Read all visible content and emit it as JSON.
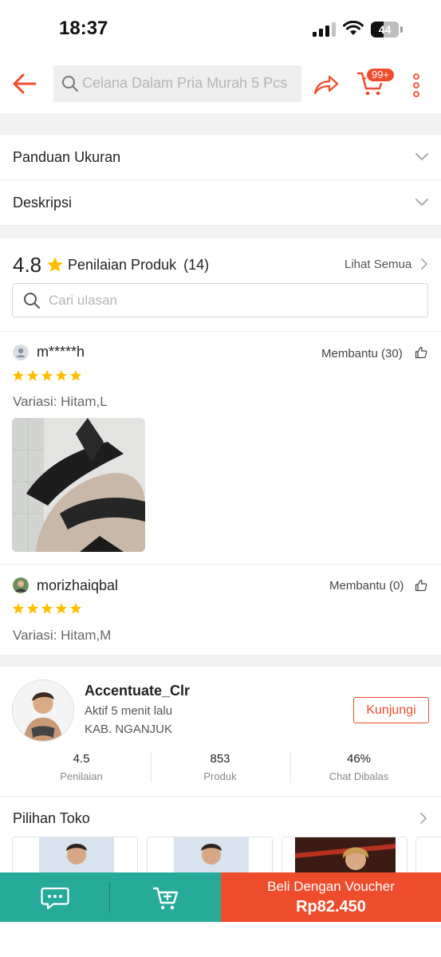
{
  "status_bar": {
    "time": "18:37",
    "battery": "44"
  },
  "header": {
    "search_placeholder": "Celana Dalam Pria Murah 5 Pcs",
    "cart_badge": "99+",
    "icons": [
      "back-arrow-icon",
      "search-icon",
      "share-icon",
      "cart-icon",
      "more-vertical-icon"
    ]
  },
  "accordion": [
    {
      "label": "Panduan Ukuran"
    },
    {
      "label": "Deskripsi"
    }
  ],
  "ratings": {
    "score": "4.8",
    "title": "Penilaian Produk",
    "count": "(14)",
    "see_all": "Lihat Semua",
    "search_placeholder": "Cari ulasan"
  },
  "reviews": [
    {
      "name": "m*****h",
      "helpful": "Membantu (30)",
      "stars": 5,
      "variation": "Variasi: Hitam,L",
      "has_photo": true
    },
    {
      "name": "morizhaiqbal",
      "helpful": "Membantu (0)",
      "stars": 5,
      "variation": "Variasi: Hitam,M",
      "has_photo": false
    }
  ],
  "shop": {
    "name": "Accentuate_Clr",
    "active": "Aktif 5 menit lalu",
    "location": "KAB. NGANJUK",
    "visit_label": "Kunjungi",
    "stats": [
      {
        "value": "4.5",
        "label": "Penilaian"
      },
      {
        "value": "853",
        "label": "Produk"
      },
      {
        "value": "46%",
        "label": "Chat Dibalas"
      }
    ]
  },
  "shop_picks": {
    "title": "Pilihan Toko"
  },
  "bottom_bar": {
    "buy_label": "Beli Dengan Voucher",
    "buy_price": "Rp82.450"
  },
  "colors": {
    "brand": "#ee4d2d",
    "teal": "#26aa99",
    "star": "#ffbf00"
  }
}
